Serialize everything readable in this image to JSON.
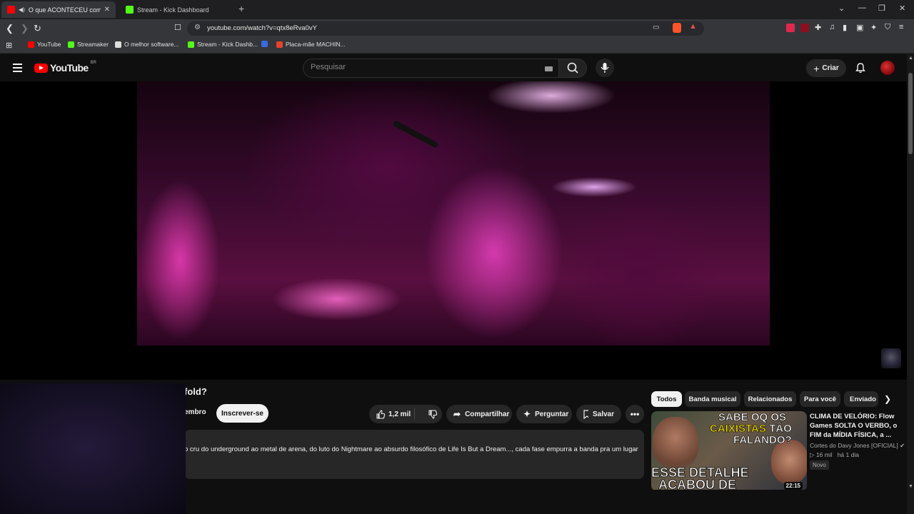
{
  "browser": {
    "tabs": [
      {
        "title": "O que ACONTECEU com o Av",
        "active": true
      },
      {
        "title": "Stream - Kick Dashboard",
        "active": false
      }
    ],
    "url": "youtube.com/watch?v=qtx8eRva0vY",
    "bookmarks": [
      {
        "label": "YouTube",
        "icon": "youtube-icon",
        "color": "#ff0000"
      },
      {
        "label": "Streamaker",
        "icon": "streamaker-icon",
        "color": "#53fc18"
      },
      {
        "label": "O melhor software...",
        "icon": "gem-icon",
        "color": "#dddddd"
      },
      {
        "label": "Stream - Kick Dashb...",
        "icon": "kick-icon",
        "color": "#53fc18"
      },
      {
        "label": "",
        "icon": "blue-icon",
        "color": "#3b6ae0"
      },
      {
        "label": "Placa-mãe MACHIN...",
        "icon": "store-icon",
        "color": "#e8412c"
      }
    ]
  },
  "youtube": {
    "logo_text": "YouTube",
    "country": "BR",
    "search_placeholder": "Pesquisar",
    "create_label": "Criar"
  },
  "video": {
    "title_visible": "fold?",
    "member_label": "embro",
    "subscribe_label": "Inscrever-se",
    "likes": "1,2 mil",
    "share_label": "Compartilhar",
    "ask_label": "Perguntar",
    "save_label": "Salvar",
    "description": "o cru do underground ao metal de arena, do luto do Nightmare ao absurdo filosófico de Life Is But a Dream..., cada fase empurra a banda pra um lugar"
  },
  "chips": [
    "Todos",
    "Banda musical",
    "Relacionados",
    "Para você",
    "Enviado"
  ],
  "recommendation": {
    "thumb_line1": "SABE OQ OS",
    "thumb_line2a": "CAIXISTAS",
    "thumb_line2b": "TÃO",
    "thumb_line3": "FALANDO?",
    "thumb_line4": "ESSE DETALHE",
    "thumb_line5": "ACABOU DE",
    "duration": "22:15",
    "title": "CLIMA DE VELÓRIO: Flow Games SOLTA O VERBO, o FIM da MÍDIA FÍSICA, a ...",
    "channel": "Cortes do Davy Jones [OFICIAL]",
    "views": "16 mil",
    "age": "há 1 dia",
    "badge": "Novo"
  },
  "colors": {
    "accent": "#ff0000",
    "kick": "#53fc18"
  }
}
